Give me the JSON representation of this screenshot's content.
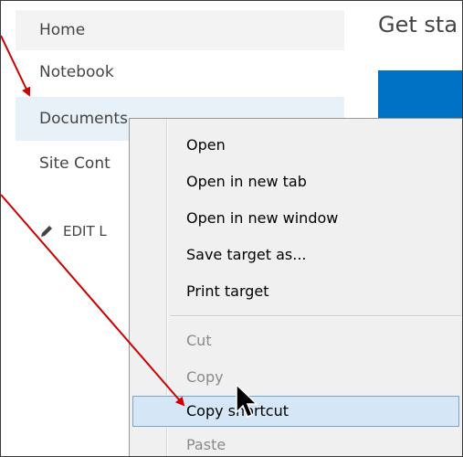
{
  "sidebar": {
    "items": [
      {
        "label": "Home"
      },
      {
        "label": "Notebook"
      },
      {
        "label": "Documents"
      },
      {
        "label": "Site Cont"
      }
    ],
    "edit_label": "EDIT L"
  },
  "main": {
    "title": "Get sta",
    "tile_color": "#0072c6"
  },
  "context_menu": {
    "items": [
      {
        "label": "Open",
        "enabled": true
      },
      {
        "label": "Open in new tab",
        "enabled": true
      },
      {
        "label": "Open in new window",
        "enabled": true
      },
      {
        "label": "Save target as...",
        "enabled": true
      },
      {
        "label": "Print target",
        "enabled": true
      },
      {
        "label": "Cut",
        "enabled": false
      },
      {
        "label": "Copy",
        "enabled": false
      },
      {
        "label": "Copy shortcut",
        "enabled": true,
        "highlighted": true
      },
      {
        "label": "Paste",
        "enabled": false
      }
    ],
    "highlight_color": "#d5e6f7"
  },
  "annotations": {
    "arrow_color": "#cc0000"
  }
}
